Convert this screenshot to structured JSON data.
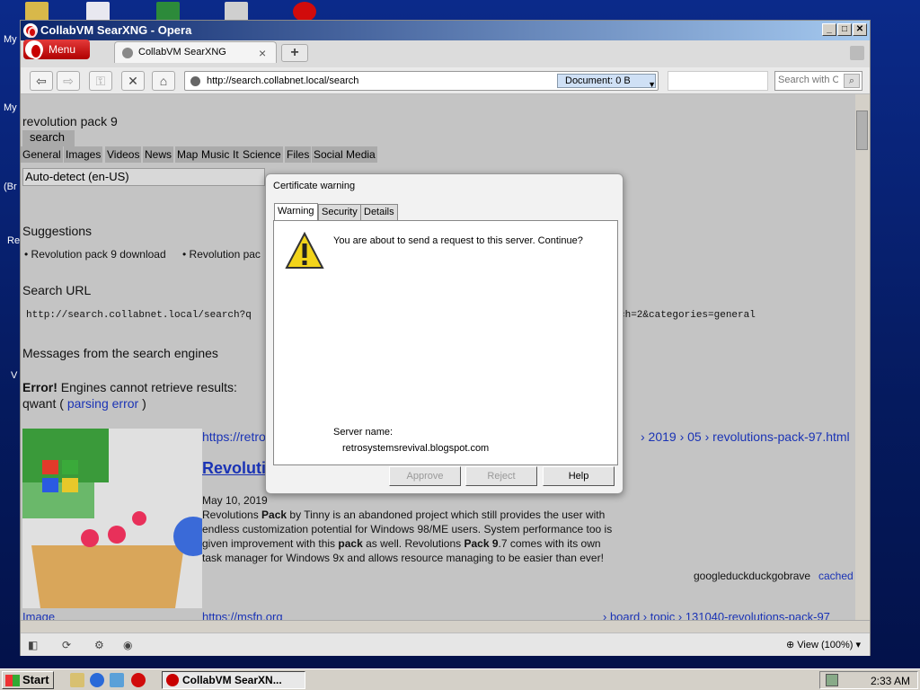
{
  "window": {
    "title": "CollabVM SearXNG - Opera"
  },
  "browser": {
    "menu_label": "Menu",
    "tab_label": "CollabVM SearXNG",
    "address_url": "http://search.collabnet.local/search",
    "document_size": "Document:   0 B",
    "search_placeholder": "Search with C",
    "zoom": "View (100%)"
  },
  "page": {
    "query": "revolution pack 9",
    "search_button": "search",
    "categories": [
      "General",
      "Images",
      "Videos",
      "News",
      "Map",
      "Music",
      "It",
      "Science",
      "Files",
      "Social Media"
    ],
    "language": "Auto-detect (en-US)",
    "suggestions_heading": "Suggestions",
    "suggestion_1": "• Revolution pack 9 download",
    "suggestion_2": "• Revolution pac",
    "search_url_heading": "Search URL",
    "search_url_left": "http://search.collabnet.local/search?q",
    "search_url_right": "ch=2&categories=general",
    "messages_heading": "Messages from the search engines",
    "error_label": "Error!",
    "error_text": " Engines cannot retrieve results:",
    "engine_name": "qwant ( ",
    "engine_error": "parsing error",
    "engine_close": " )",
    "result1_url": "https://retro",
    "result1_path": "› 2019 › 05 › revolutions-pack-97.html",
    "result1_title": "Revolutio",
    "result1_date": "May 10, 2019",
    "result1_snippet_1a": "Revolutions ",
    "result1_snippet_1b": "Pack",
    "result1_snippet_1c": " by Tinny is an abandoned project which still provides the user with",
    "result1_snippet_2": "endless customization potential for Windows 98/ME users. System performance too is",
    "result1_snippet_3a": "given improvement with this ",
    "result1_snippet_3b": "pack",
    "result1_snippet_3c": " as well. Revolutions ",
    "result1_snippet_3d": "Pack 9",
    "result1_snippet_3e": ".7 comes with its own",
    "result1_snippet_4": "task manager for Windows 9x and allows resource managing to be easier than ever!",
    "result1_engines": "googleduckduckgobrave",
    "result1_cached": "cached",
    "image_label": "Image",
    "result2_url": "https://msfn.org",
    "result2_path": "› board › topic › 131040-revolutions-pack-97"
  },
  "dialog": {
    "title": "Certificate warning",
    "tabs": [
      "Warning",
      "Security",
      "Details"
    ],
    "message": "You are about to send a request to this server. Continue?",
    "server_label": "Server name:",
    "server_value": "retrosystemsrevival.blogspot.com",
    "buttons": {
      "approve": "Approve",
      "reject": "Reject",
      "help": "Help"
    }
  },
  "taskbar": {
    "start": "Start",
    "task": "CollabVM SearXN...",
    "clock": "2:33 AM"
  },
  "desktop": {
    "labels": [
      "My",
      "My",
      "(Br",
      "Re",
      "V"
    ]
  },
  "colors": {
    "link": "#1a33b5",
    "title_start": "#0a246a",
    "menu_red": "#c80000"
  }
}
